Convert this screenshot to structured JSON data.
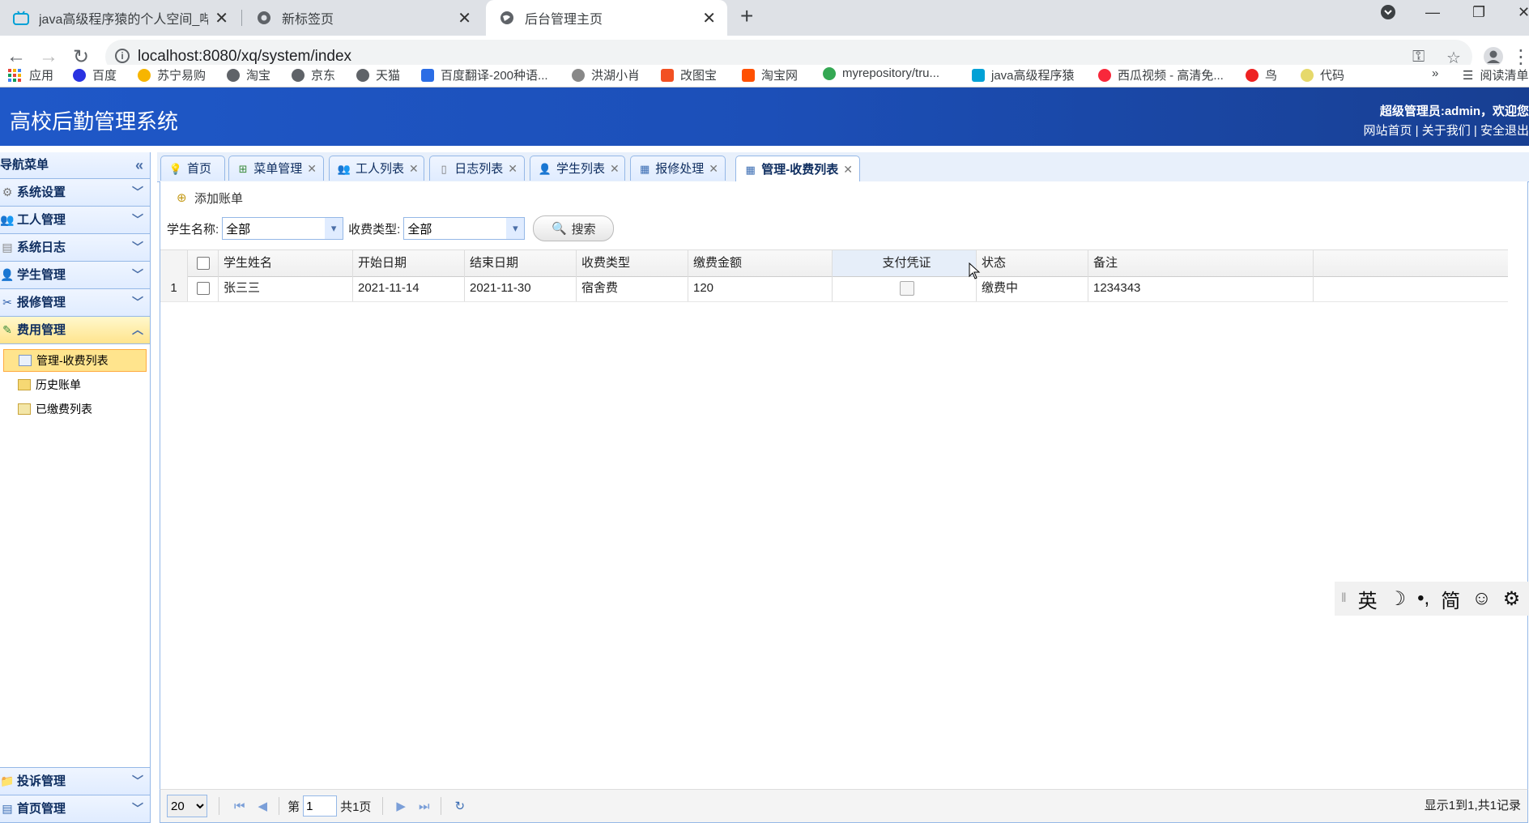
{
  "browser": {
    "tabs": [
      {
        "title": "java高级程序猿的个人空间_哔哩"
      },
      {
        "title": "新标签页"
      },
      {
        "title": "后台管理主页"
      }
    ],
    "url": "localhost:8080/xq/system/index",
    "bookmarks": [
      {
        "label": "应用",
        "color": "#e8453c"
      },
      {
        "label": "百度",
        "color": "#2932e1"
      },
      {
        "label": "苏宁易购",
        "color": "#f7b500"
      },
      {
        "label": "淘宝",
        "color": "#5f6368"
      },
      {
        "label": "京东",
        "color": "#5f6368"
      },
      {
        "label": "天猫",
        "color": "#5f6368"
      },
      {
        "label": "百度翻译-200种语...",
        "color": "#2b6de5"
      },
      {
        "label": "洪湖小肖",
        "color": "#888888"
      },
      {
        "label": "改图宝",
        "color": "#f25022"
      },
      {
        "label": "淘宝网",
        "color": "#ff5000"
      },
      {
        "label": "myrepository/tru...",
        "color": "#34a853"
      },
      {
        "label": "java高级程序猿",
        "color": "#00a1d6"
      },
      {
        "label": "西瓜视频 - 高清免...",
        "color": "#f8283b"
      },
      {
        "label": "鸟",
        "color": "#e22"
      },
      {
        "label": "代码",
        "color": "#e6d96b"
      }
    ],
    "reading_list": "阅读清单"
  },
  "app": {
    "title": "高校后勤管理系统",
    "user_text": "超级管理员:admin，欢迎您",
    "links": [
      "网站首页",
      "关于我们",
      "安全退出"
    ]
  },
  "sidebar": {
    "header": "导航菜单",
    "menus": [
      {
        "label": "系统设置",
        "icon": "gear-icon"
      },
      {
        "label": "工人管理",
        "icon": "workers-icon"
      },
      {
        "label": "系统日志",
        "icon": "log-icon"
      },
      {
        "label": "学生管理",
        "icon": "student-icon"
      },
      {
        "label": "报修管理",
        "icon": "tools-icon"
      },
      {
        "label": "费用管理",
        "icon": "money-icon"
      }
    ],
    "sub_items": [
      {
        "label": "管理-收费列表"
      },
      {
        "label": "历史账单"
      },
      {
        "label": "已缴费列表"
      }
    ],
    "bottom_menus": [
      {
        "label": "投诉管理"
      },
      {
        "label": "首页管理"
      }
    ]
  },
  "page_tabs": [
    {
      "label": "首页",
      "icon": "bulb-icon"
    },
    {
      "label": "菜单管理",
      "icon": "menu-tree-icon"
    },
    {
      "label": "工人列表",
      "icon": "workers-icon"
    },
    {
      "label": "日志列表",
      "icon": "document-icon"
    },
    {
      "label": "学生列表",
      "icon": "student-icon"
    },
    {
      "label": "报修处理",
      "icon": "table-icon"
    },
    {
      "label": "管理-收费列表",
      "icon": "table-icon"
    }
  ],
  "toolbar": {
    "add_label": "添加账单"
  },
  "search": {
    "student_label": "学生名称:",
    "student_value": "全部",
    "type_label": "收费类型:",
    "type_value": "全部",
    "button_label": "搜索"
  },
  "grid": {
    "columns": [
      "学生姓名",
      "开始日期",
      "结束日期",
      "收费类型",
      "缴费金额",
      "支付凭证",
      "状态",
      "备注"
    ],
    "rows": [
      {
        "no": "1",
        "name": "张三三",
        "start": "2021-11-14",
        "end": "2021-11-30",
        "type": "宿舍费",
        "amount": "120",
        "status": "缴费中",
        "remark": "1234343"
      }
    ]
  },
  "pager": {
    "page_size": "20",
    "page_prefix": "第",
    "page_value": "1",
    "page_total": "共1页",
    "info": "显示1到1,共1记录"
  },
  "ime": {
    "items": [
      "英",
      "☽",
      "•,",
      "简",
      "☺",
      "⚙"
    ]
  }
}
